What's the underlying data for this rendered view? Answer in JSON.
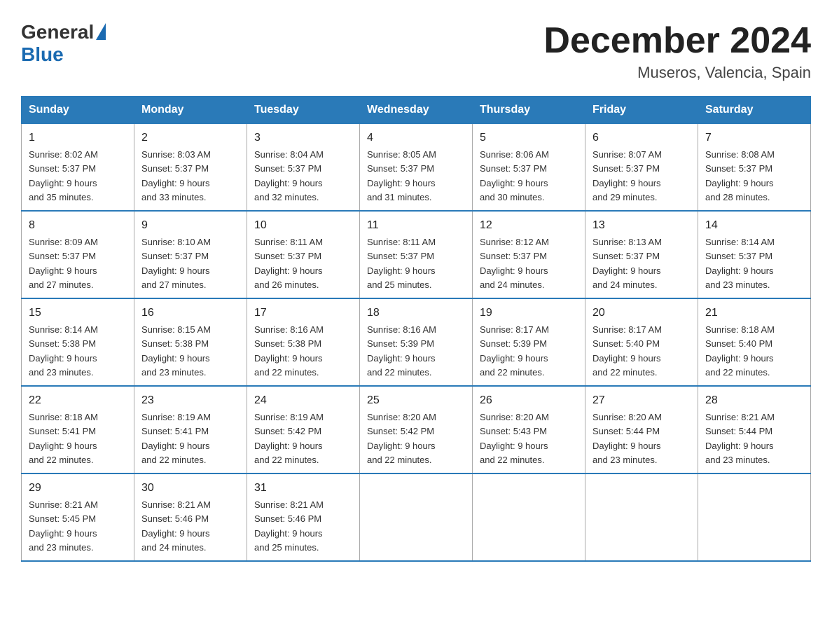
{
  "header": {
    "logo_general": "General",
    "logo_blue": "Blue",
    "month_title": "December 2024",
    "location": "Museros, Valencia, Spain"
  },
  "days_of_week": [
    "Sunday",
    "Monday",
    "Tuesday",
    "Wednesday",
    "Thursday",
    "Friday",
    "Saturday"
  ],
  "weeks": [
    [
      {
        "day": "1",
        "sunrise": "8:02 AM",
        "sunset": "5:37 PM",
        "daylight": "9 hours and 35 minutes."
      },
      {
        "day": "2",
        "sunrise": "8:03 AM",
        "sunset": "5:37 PM",
        "daylight": "9 hours and 33 minutes."
      },
      {
        "day": "3",
        "sunrise": "8:04 AM",
        "sunset": "5:37 PM",
        "daylight": "9 hours and 32 minutes."
      },
      {
        "day": "4",
        "sunrise": "8:05 AM",
        "sunset": "5:37 PM",
        "daylight": "9 hours and 31 minutes."
      },
      {
        "day": "5",
        "sunrise": "8:06 AM",
        "sunset": "5:37 PM",
        "daylight": "9 hours and 30 minutes."
      },
      {
        "day": "6",
        "sunrise": "8:07 AM",
        "sunset": "5:37 PM",
        "daylight": "9 hours and 29 minutes."
      },
      {
        "day": "7",
        "sunrise": "8:08 AM",
        "sunset": "5:37 PM",
        "daylight": "9 hours and 28 minutes."
      }
    ],
    [
      {
        "day": "8",
        "sunrise": "8:09 AM",
        "sunset": "5:37 PM",
        "daylight": "9 hours and 27 minutes."
      },
      {
        "day": "9",
        "sunrise": "8:10 AM",
        "sunset": "5:37 PM",
        "daylight": "9 hours and 27 minutes."
      },
      {
        "day": "10",
        "sunrise": "8:11 AM",
        "sunset": "5:37 PM",
        "daylight": "9 hours and 26 minutes."
      },
      {
        "day": "11",
        "sunrise": "8:11 AM",
        "sunset": "5:37 PM",
        "daylight": "9 hours and 25 minutes."
      },
      {
        "day": "12",
        "sunrise": "8:12 AM",
        "sunset": "5:37 PM",
        "daylight": "9 hours and 24 minutes."
      },
      {
        "day": "13",
        "sunrise": "8:13 AM",
        "sunset": "5:37 PM",
        "daylight": "9 hours and 24 minutes."
      },
      {
        "day": "14",
        "sunrise": "8:14 AM",
        "sunset": "5:37 PM",
        "daylight": "9 hours and 23 minutes."
      }
    ],
    [
      {
        "day": "15",
        "sunrise": "8:14 AM",
        "sunset": "5:38 PM",
        "daylight": "9 hours and 23 minutes."
      },
      {
        "day": "16",
        "sunrise": "8:15 AM",
        "sunset": "5:38 PM",
        "daylight": "9 hours and 23 minutes."
      },
      {
        "day": "17",
        "sunrise": "8:16 AM",
        "sunset": "5:38 PM",
        "daylight": "9 hours and 22 minutes."
      },
      {
        "day": "18",
        "sunrise": "8:16 AM",
        "sunset": "5:39 PM",
        "daylight": "9 hours and 22 minutes."
      },
      {
        "day": "19",
        "sunrise": "8:17 AM",
        "sunset": "5:39 PM",
        "daylight": "9 hours and 22 minutes."
      },
      {
        "day": "20",
        "sunrise": "8:17 AM",
        "sunset": "5:40 PM",
        "daylight": "9 hours and 22 minutes."
      },
      {
        "day": "21",
        "sunrise": "8:18 AM",
        "sunset": "5:40 PM",
        "daylight": "9 hours and 22 minutes."
      }
    ],
    [
      {
        "day": "22",
        "sunrise": "8:18 AM",
        "sunset": "5:41 PM",
        "daylight": "9 hours and 22 minutes."
      },
      {
        "day": "23",
        "sunrise": "8:19 AM",
        "sunset": "5:41 PM",
        "daylight": "9 hours and 22 minutes."
      },
      {
        "day": "24",
        "sunrise": "8:19 AM",
        "sunset": "5:42 PM",
        "daylight": "9 hours and 22 minutes."
      },
      {
        "day": "25",
        "sunrise": "8:20 AM",
        "sunset": "5:42 PM",
        "daylight": "9 hours and 22 minutes."
      },
      {
        "day": "26",
        "sunrise": "8:20 AM",
        "sunset": "5:43 PM",
        "daylight": "9 hours and 22 minutes."
      },
      {
        "day": "27",
        "sunrise": "8:20 AM",
        "sunset": "5:44 PM",
        "daylight": "9 hours and 23 minutes."
      },
      {
        "day": "28",
        "sunrise": "8:21 AM",
        "sunset": "5:44 PM",
        "daylight": "9 hours and 23 minutes."
      }
    ],
    [
      {
        "day": "29",
        "sunrise": "8:21 AM",
        "sunset": "5:45 PM",
        "daylight": "9 hours and 23 minutes."
      },
      {
        "day": "30",
        "sunrise": "8:21 AM",
        "sunset": "5:46 PM",
        "daylight": "9 hours and 24 minutes."
      },
      {
        "day": "31",
        "sunrise": "8:21 AM",
        "sunset": "5:46 PM",
        "daylight": "9 hours and 25 minutes."
      },
      null,
      null,
      null,
      null
    ]
  ],
  "labels": {
    "sunrise": "Sunrise:",
    "sunset": "Sunset:",
    "daylight": "Daylight:"
  }
}
